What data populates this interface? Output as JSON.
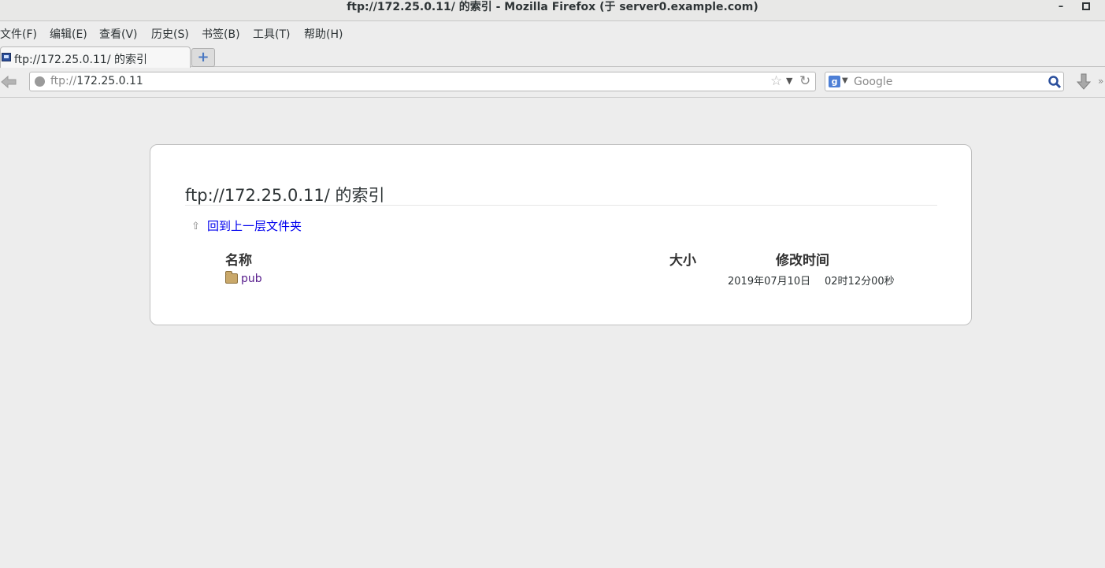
{
  "window": {
    "title": "ftp://172.25.0.11/ 的索引  -  Mozilla Firefox (于  server0.example.com)",
    "minimize_glyph": "–"
  },
  "menubar": {
    "items": [
      "文件(F)",
      "编辑(E)",
      "查看(V)",
      "历史(S)",
      "书签(B)",
      "工具(T)",
      "帮助(H)"
    ]
  },
  "tabs": [
    {
      "label": "ftp://172.25.0.11/ 的索引",
      "icon": "monitor-icon",
      "active": true
    }
  ],
  "newtab": {
    "glyph": "+"
  },
  "navbar": {
    "url_scheme": "ftp://",
    "url_host": "172.25.0.11",
    "search_engine_label": "g",
    "search_placeholder": "Google"
  },
  "listing": {
    "heading": "ftp://172.25.0.11/ 的索引",
    "up_link_label": "回到上一层文件夹",
    "columns": {
      "name": "名称",
      "size": "大小",
      "modified": "修改时间"
    },
    "rows": [
      {
        "name": "pub",
        "type": "folder",
        "size": "",
        "date": "2019年07月10日",
        "time": "02时12分00秒"
      }
    ]
  },
  "colors": {
    "link": "#0000ee",
    "visited_link": "#551a8b",
    "page_background": "#ededed"
  }
}
